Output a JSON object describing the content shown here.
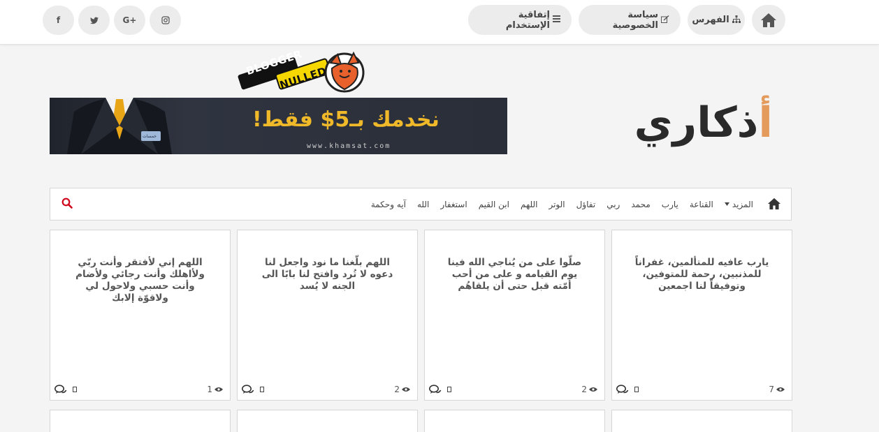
{
  "colors": {
    "accent": "#e39a5b",
    "search_red": "#d0021b",
    "banner_gold": "#f0b92a"
  },
  "social": [
    {
      "icon": "facebook-icon",
      "glyph": "f"
    },
    {
      "icon": "twitter-icon",
      "glyph": "t"
    },
    {
      "icon": "google-plus-icon",
      "glyph": "G+"
    },
    {
      "icon": "instagram-icon",
      "glyph": "◎"
    }
  ],
  "topnav": {
    "index_label": "الفهرس",
    "privacy_label": "سياسة الخصوصية",
    "terms_label": "إتفاقية الإستخدام"
  },
  "badge": {
    "line1": "BLOGGER",
    "line2": "NULLED"
  },
  "banner": {
    "headline": "نخدمك بـ5$ فقط!",
    "url": "www.khamsat.com",
    "tag": "خمسات"
  },
  "site_logo": {
    "first": "أ",
    "rest": "ذكاري"
  },
  "menu": {
    "items": [
      "آيه وحكمة",
      "الله",
      "استغفار",
      "ابن القيم",
      "اللهم",
      "الوتر",
      "تفاؤل",
      "ربي",
      "محمد",
      "يارب",
      "القناعة"
    ],
    "more_label": "المزيد"
  },
  "cards": [
    {
      "text": "يارب عافيه للمتألمين، غفراناً للمذنبين، رحمة للمتوفين، وتوفيقاً لنا اجمعين",
      "views": "7"
    },
    {
      "text": "صلّوا على من يُناجي الله فينا يوم القيامه و على من أحب أمّته قبل حتى أن يلقاهُم",
      "views": "2"
    },
    {
      "text": "اللهم بلّغنا ما نود واجعل لنا دعوه لا تُرد وافتح لنا بابًا الى الجنه لا يُسد",
      "views": "2"
    },
    {
      "text": "اللهم إني لأفتقر وأنت ربّي ولأاهلك وأنت رجائي ولأضام وأنت حسبي ولاحول لي ولاقوّة إلابك",
      "views": "1"
    }
  ]
}
